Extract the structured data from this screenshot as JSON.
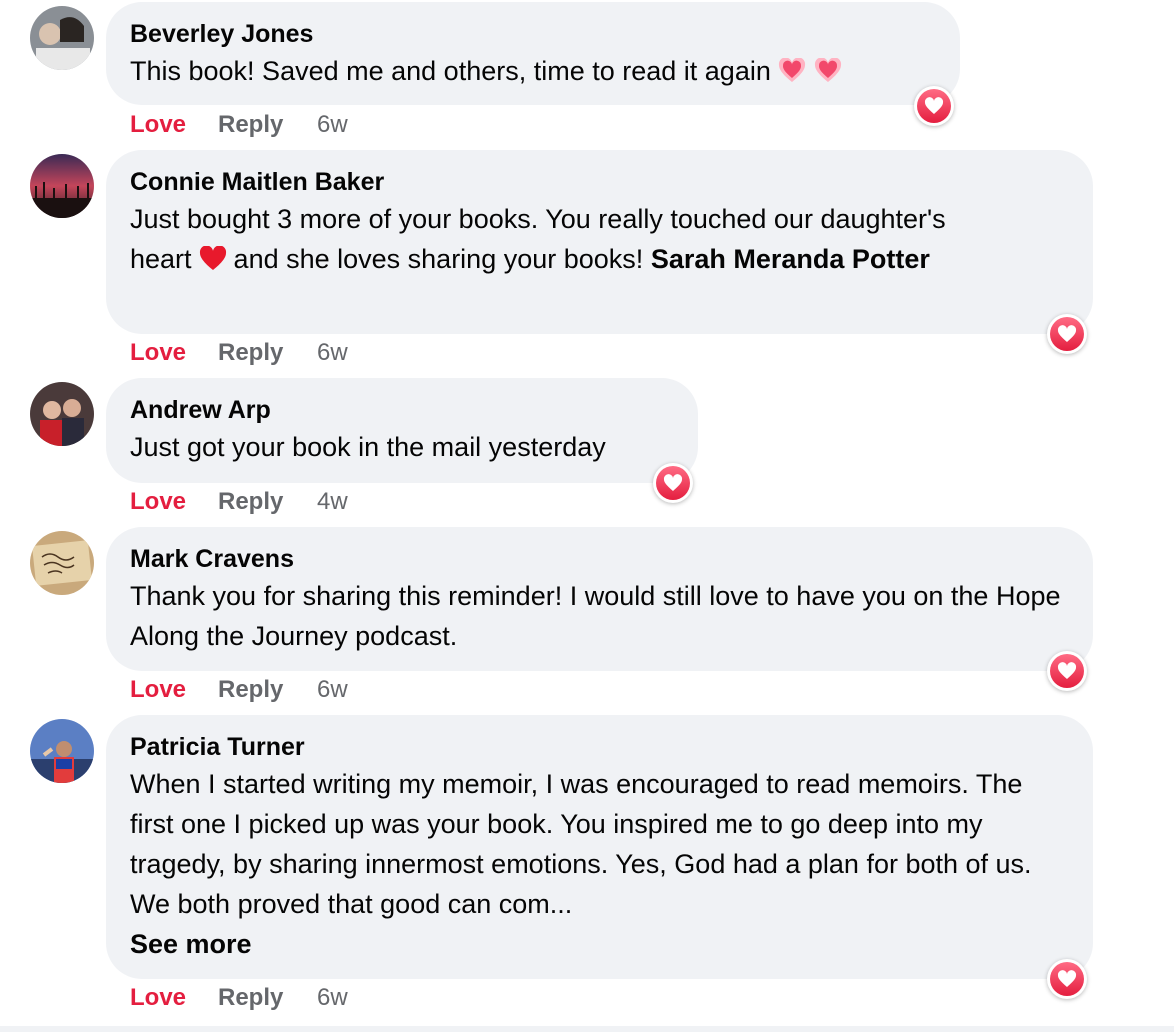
{
  "colors": {
    "bubble": "#f0f2f5",
    "love": "#e41e3f",
    "meta": "#65676b"
  },
  "comments": [
    {
      "author": "Beverley Jones",
      "text": "This book! Saved me and others, time to read it again",
      "emoji": "sparkling-heart-icon x2",
      "love_label": "Love",
      "reply_label": "Reply",
      "time": "6w",
      "reaction": "love-reaction-icon"
    },
    {
      "author": "Connie Maitlen Baker",
      "text_part1": "Just bought 3 more of your books. You really touched our daughter's heart",
      "text_part2": "and she loves sharing your books!",
      "mention": "Sarah Meranda Potter",
      "emoji": "red-heart-icon",
      "love_label": "Love",
      "reply_label": "Reply",
      "time": "6w",
      "reaction": "love-reaction-icon"
    },
    {
      "author": "Andrew Arp",
      "text": "Just got your book in the mail yesterday",
      "love_label": "Love",
      "reply_label": "Reply",
      "time": "4w",
      "reaction": "love-reaction-icon"
    },
    {
      "author": "Mark Cravens",
      "text": "Thank you for sharing this reminder! I would still love to have you on the Hope Along the Journey podcast.",
      "love_label": "Love",
      "reply_label": "Reply",
      "time": "6w",
      "reaction": "love-reaction-icon"
    },
    {
      "author": "Patricia Turner",
      "text": "When I started writing my memoir, I was encouraged to read memoirs. The first one I picked up was your book. You inspired me to go deep into my tragedy, by sharing innermost emotions. Yes, God had a plan for both of us. We both proved that good can com...",
      "see_more": "See more",
      "love_label": "Love",
      "reply_label": "Reply",
      "time": "6w",
      "reaction": "love-reaction-icon"
    }
  ]
}
